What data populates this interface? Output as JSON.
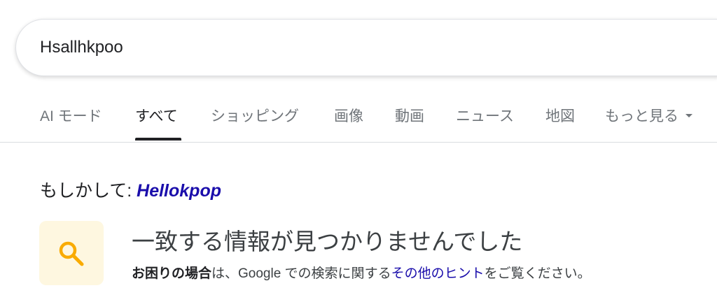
{
  "search": {
    "query": "Hsallhkpoo"
  },
  "tabs": [
    {
      "label": "AI モード",
      "active": false
    },
    {
      "label": "すべて",
      "active": true
    },
    {
      "label": "ショッピング",
      "active": false
    },
    {
      "label": "画像",
      "active": false
    },
    {
      "label": "動画",
      "active": false
    },
    {
      "label": "ニュース",
      "active": false
    },
    {
      "label": "地図",
      "active": false
    },
    {
      "label": "もっと見る",
      "active": false
    }
  ],
  "did_you_mean": {
    "prefix": "もしかして: ",
    "suggestion": "Hellokpop"
  },
  "no_results": {
    "icon": "search-icon",
    "title": "一致する情報が見つかりませんでした",
    "desc_bold": "お困りの場合",
    "desc_part1": "は、Google での検索に関する",
    "desc_link": "その他のヒント",
    "desc_part2": "をご覧ください。"
  },
  "colors": {
    "link": "#1a0dab",
    "icon_tile_bg": "#fef7e0",
    "icon": "#f9ab00"
  }
}
